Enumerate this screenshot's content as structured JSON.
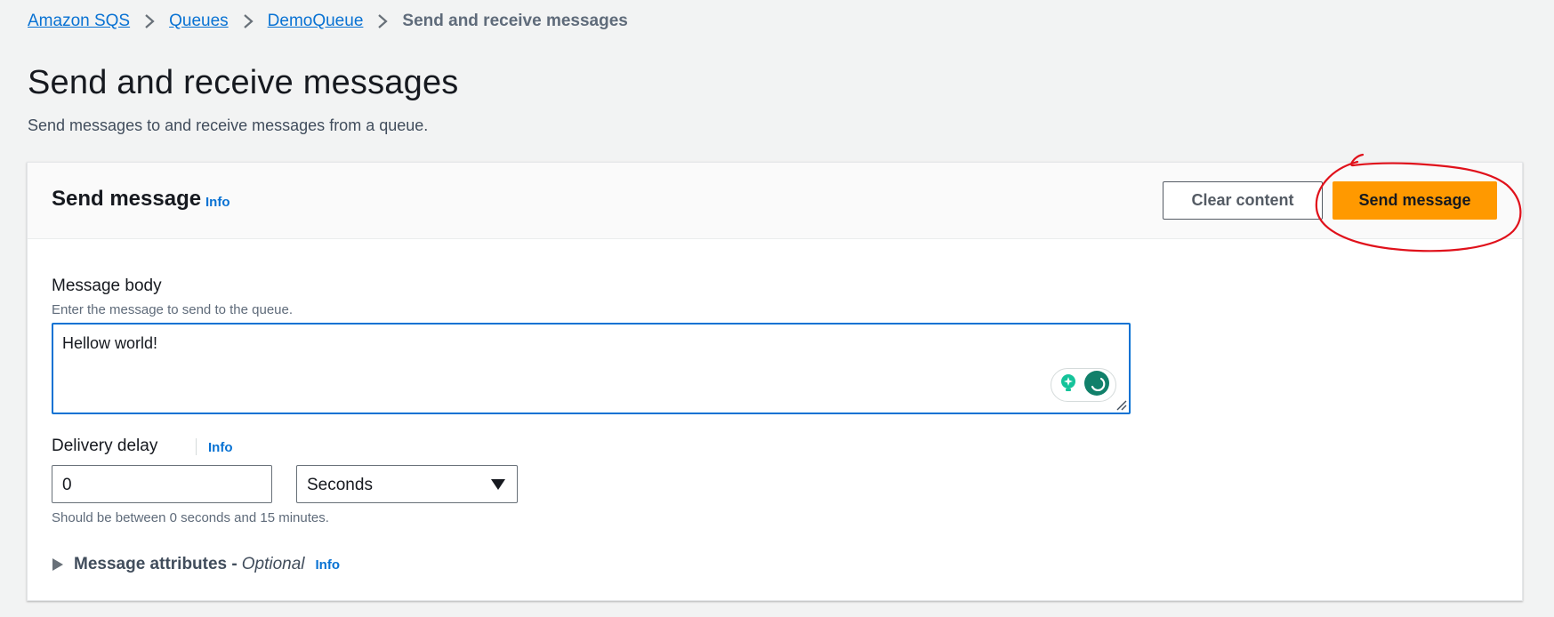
{
  "breadcrumb": {
    "items": [
      "Amazon SQS",
      "Queues",
      "DemoQueue"
    ],
    "current": "Send and receive messages"
  },
  "header": {
    "title": "Send and receive messages",
    "description": "Send messages to and receive messages from a queue."
  },
  "send_message": {
    "title": "Send message",
    "info": "Info",
    "clear_label": "Clear content",
    "send_label": "Send message"
  },
  "message_body": {
    "label": "Message body",
    "description": "Enter the message to send to the queue.",
    "value": "Hellow world!"
  },
  "delivery_delay": {
    "label": "Delivery delay",
    "info": "Info",
    "value": "0",
    "unit": "Seconds",
    "constraint": "Should be between 0 seconds and 15 minutes."
  },
  "attributes": {
    "label": "Message attributes -",
    "optional": "Optional",
    "info": "Info"
  },
  "colors": {
    "link": "#0972d3",
    "primary_button": "#ff9900",
    "annotation": "#e0111b"
  }
}
